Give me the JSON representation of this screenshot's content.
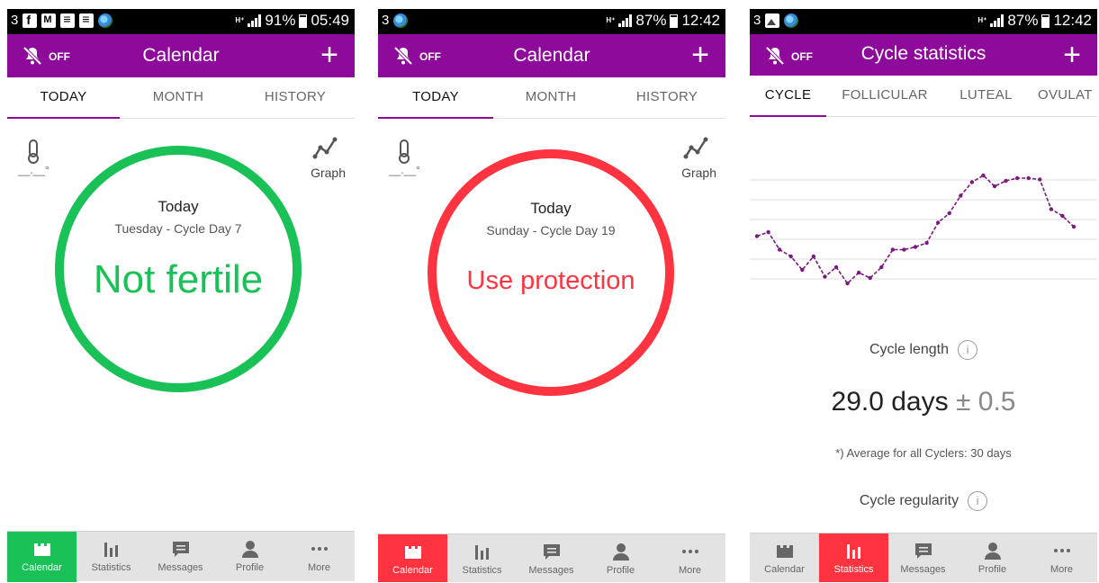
{
  "colors": {
    "brand": "#8e0a9b",
    "fertile_safe": "#19c157",
    "fertile_unsafe": "#ff3440",
    "chart_line": "#7b1a7e"
  },
  "screens": [
    {
      "status": {
        "left_text": "3",
        "battery": "91%",
        "time": "05:49"
      },
      "appbar": {
        "notify_label": "OFF",
        "title": "Calendar",
        "add_label": "+"
      },
      "tabs": [
        "TODAY",
        "MONTH",
        "HISTORY"
      ],
      "temperature_placeholder": "__.__°",
      "graph_label": "Graph",
      "ring": {
        "today": "Today",
        "subtitle": "Tuesday - Cycle Day 7",
        "status": "Not fertile"
      },
      "nav": [
        "Calendar",
        "Statistics",
        "Messages",
        "Profile",
        "More"
      ]
    },
    {
      "status": {
        "left_text": "3",
        "battery": "87%",
        "time": "12:42"
      },
      "appbar": {
        "notify_label": "OFF",
        "title": "Calendar",
        "add_label": "+"
      },
      "tabs": [
        "TODAY",
        "MONTH",
        "HISTORY"
      ],
      "temperature_placeholder": "__.__°",
      "graph_label": "Graph",
      "ring": {
        "today": "Today",
        "subtitle": "Sunday - Cycle Day 19",
        "status": "Use protection"
      },
      "nav": [
        "Calendar",
        "Statistics",
        "Messages",
        "Profile",
        "More"
      ]
    },
    {
      "status": {
        "left_text": "3",
        "battery": "87%",
        "time": "12:42"
      },
      "appbar": {
        "notify_label": "OFF",
        "title": "Cycle statistics",
        "add_label": "+"
      },
      "tabs": [
        "CYCLE",
        "FOLLICULAR",
        "LUTEAL",
        "OVULAT"
      ],
      "stats": {
        "cycle_length_label": "Cycle length",
        "cycle_length_value": "29.0 days",
        "cycle_length_pm": "± 0.5",
        "average_note": "*) Average for all Cyclers: 30 days",
        "regularity_label": "Cycle regularity",
        "info_symbol": "i"
      },
      "nav": [
        "Calendar",
        "Statistics",
        "Messages",
        "Profile",
        "More"
      ]
    }
  ],
  "chart_data": {
    "type": "line",
    "title": "",
    "xlabel": "",
    "ylabel": "",
    "grid": true,
    "series": [
      {
        "values": [
          0.45,
          0.48,
          0.35,
          0.3,
          0.2,
          0.3,
          0.15,
          0.22,
          0.1,
          0.18,
          0.14,
          0.22,
          0.35,
          0.35,
          0.37,
          0.4,
          0.55,
          0.62,
          0.75,
          0.85,
          0.9,
          0.82,
          0.86,
          0.88,
          0.88,
          0.87,
          0.65,
          0.6,
          0.52
        ]
      }
    ],
    "ylim": [
      0,
      1
    ]
  }
}
